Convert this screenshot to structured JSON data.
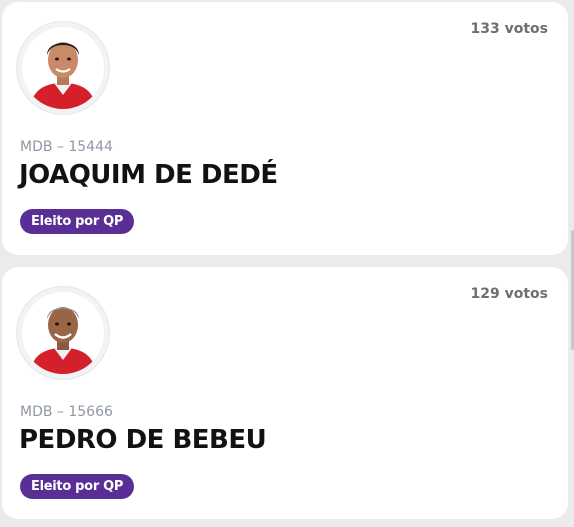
{
  "candidates": [
    {
      "votes": "133 votos",
      "party": "MDB – 15444",
      "name": "JOAQUIM DE DEDÉ",
      "status": "Eleito por QP",
      "photo_icon": "candidate-photo-icon"
    },
    {
      "votes": "129 votos",
      "party": "MDB – 15666",
      "name": "PEDRO DE BEBEU",
      "status": "Eleito por QP",
      "photo_icon": "candidate-photo-icon"
    }
  ],
  "colors": {
    "badge": "#5a2f95",
    "shirt": "#d4202a",
    "background": "#ebebed"
  }
}
